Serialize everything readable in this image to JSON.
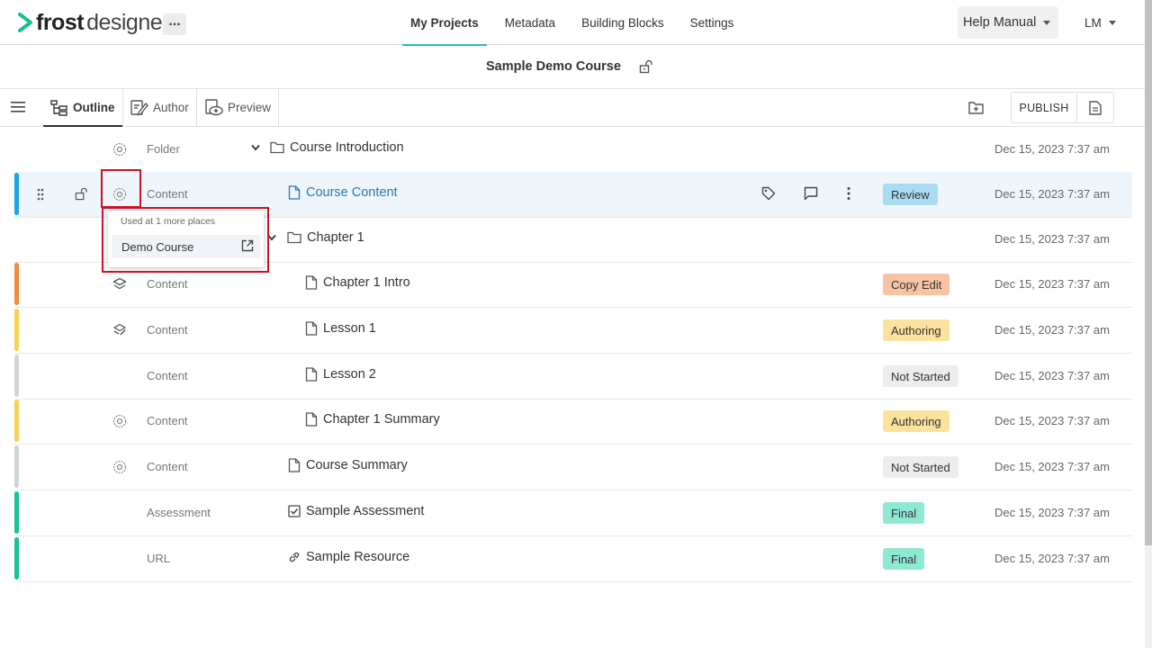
{
  "app": {
    "brand_bold": "frost",
    "brand_light": "designer",
    "more": "..."
  },
  "nav": {
    "tabs": [
      {
        "label": "My Projects",
        "active": true
      },
      {
        "label": "Metadata"
      },
      {
        "label": "Building Blocks"
      },
      {
        "label": "Settings"
      }
    ],
    "help": "Help Manual",
    "user": "LM"
  },
  "course": {
    "title": "Sample Demo Course"
  },
  "toolbar": {
    "views": [
      {
        "label": "Outline",
        "active": true
      },
      {
        "label": "Author"
      },
      {
        "label": "Preview"
      }
    ],
    "publish": "PUBLISH"
  },
  "rows": [
    {
      "type": "Folder",
      "title": "Course Introduction",
      "status": "",
      "date": "Dec 15, 2023 7:37 am"
    },
    {
      "type": "Content",
      "title": "Course Content",
      "status": "Review",
      "date": "Dec 15, 2023 7:37 am"
    },
    {
      "type": "",
      "title": "Chapter 1",
      "status": "",
      "date": "Dec 15, 2023 7:37 am"
    },
    {
      "type": "Content",
      "title": "Chapter 1 Intro",
      "status": "Copy Edit",
      "date": "Dec 15, 2023 7:37 am"
    },
    {
      "type": "Content",
      "title": "Lesson 1",
      "status": "Authoring",
      "date": "Dec 15, 2023 7:37 am"
    },
    {
      "type": "Content",
      "title": "Lesson 2",
      "status": "Not Started",
      "date": "Dec 15, 2023 7:37 am"
    },
    {
      "type": "Content",
      "title": "Chapter 1 Summary",
      "status": "Authoring",
      "date": "Dec 15, 2023 7:37 am"
    },
    {
      "type": "Content",
      "title": "Course Summary",
      "status": "Not Started",
      "date": "Dec 15, 2023 7:37 am"
    },
    {
      "type": "Assessment",
      "title": "Sample Assessment",
      "status": "Final",
      "date": "Dec 15, 2023 7:37 am"
    },
    {
      "type": "URL",
      "title": "Sample Resource",
      "status": "Final",
      "date": "Dec 15, 2023 7:37 am"
    }
  ],
  "popup": {
    "heading": "Used at 1 more places",
    "item": "Demo Course"
  },
  "colors": {
    "accent": "#27b8c6",
    "review": "#a9dbf3",
    "copy_edit": "#f8c3a4",
    "authoring": "#fbe29d",
    "not_started": "#ececec",
    "final": "#8de8d4",
    "bar_blue": "#1aa3e8",
    "bar_orange": "#f58a3b",
    "bar_yellow": "#f8d254",
    "bar_gray": "#cfd6da",
    "bar_teal": "#16c29a"
  }
}
